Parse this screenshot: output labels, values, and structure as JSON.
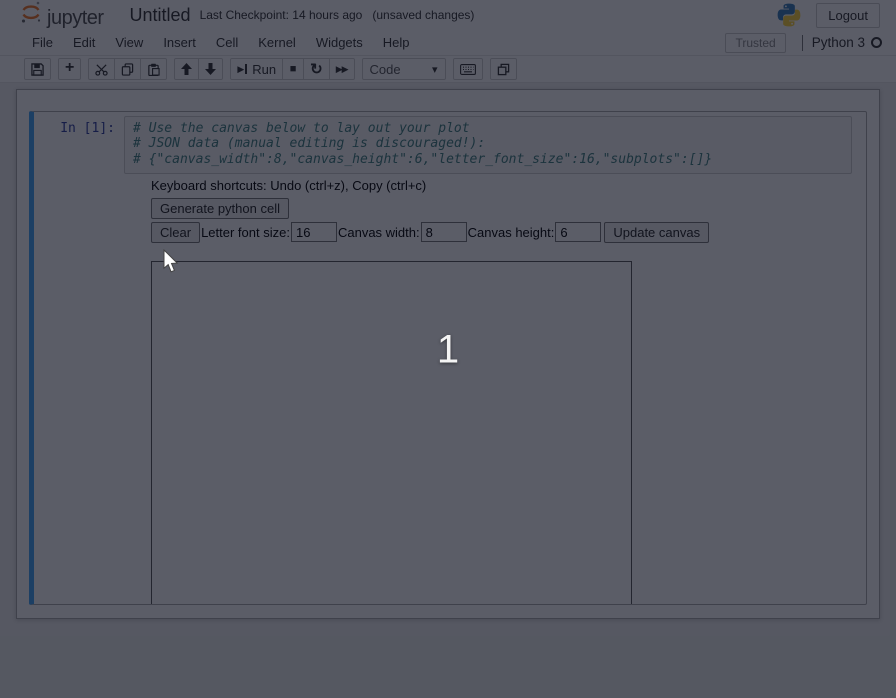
{
  "header": {
    "logo_text": "jupyter",
    "title": "Untitled",
    "checkpoint": "Last Checkpoint: 14 hours ago",
    "autosave_status": "(unsaved changes)",
    "logout_label": "Logout"
  },
  "menubar": {
    "items": [
      {
        "label": "File"
      },
      {
        "label": "Edit"
      },
      {
        "label": "View"
      },
      {
        "label": "Insert"
      },
      {
        "label": "Cell"
      },
      {
        "label": "Kernel"
      },
      {
        "label": "Widgets"
      },
      {
        "label": "Help"
      }
    ],
    "trusted_label": "Trusted",
    "kernel_name": "Python 3"
  },
  "toolbar": {
    "run_label": "Run",
    "cell_type_value": "Code"
  },
  "cell": {
    "prompt": "In [1]:",
    "code_lines": [
      "# Use the canvas below to lay out your plot",
      "# JSON data (manual editing is discouraged!):",
      "# {\"canvas_width\":8,\"canvas_height\":6,\"letter_font_size\":16,\"subplots\":[]}"
    ]
  },
  "widget": {
    "shortcuts_text": "Keyboard shortcuts: Undo (ctrl+z), Copy (ctrl+c)",
    "generate_label": "Generate python cell",
    "clear_label": "Clear",
    "font_size_label": "Letter font size:",
    "font_size_value": "16",
    "canvas_width_label": "Canvas width:",
    "canvas_width_value": "8",
    "canvas_height_label": "Canvas height:",
    "canvas_height_value": "6",
    "update_label": "Update canvas"
  },
  "overlay": {
    "key_display": "1"
  },
  "icons": {
    "jupyter-logo-icon": "orange dotted-circle arcs",
    "python-logo-icon": "blue/yellow twin snakes",
    "save-icon": "floppy disk",
    "add-cell-icon": "+",
    "cut-icon": "scissors",
    "copy-icon": "two pages",
    "paste-icon": "clipboard",
    "move-up-icon": "↑",
    "move-down-icon": "↓",
    "run-icon": "step-forward",
    "stop-icon": "■",
    "restart-icon": "↻",
    "restart-run-all-icon": "»",
    "chevron-down-icon": "▾",
    "keyboard-icon": "keyboard",
    "command-palette-icon": "overlapping squares",
    "kernel-idle-icon": "○",
    "cursor-icon": "arrow pointer"
  },
  "colors": {
    "selected_cell_accent": "#42A5F5",
    "jupyter_orange": "#F37726",
    "python_blue": "#387EB8",
    "python_yellow": "#FFD43B",
    "prompt_blue": "#303F9F",
    "comment_teal": "#408080",
    "dim_overlay": "rgba(10,14,28,0.67)"
  }
}
